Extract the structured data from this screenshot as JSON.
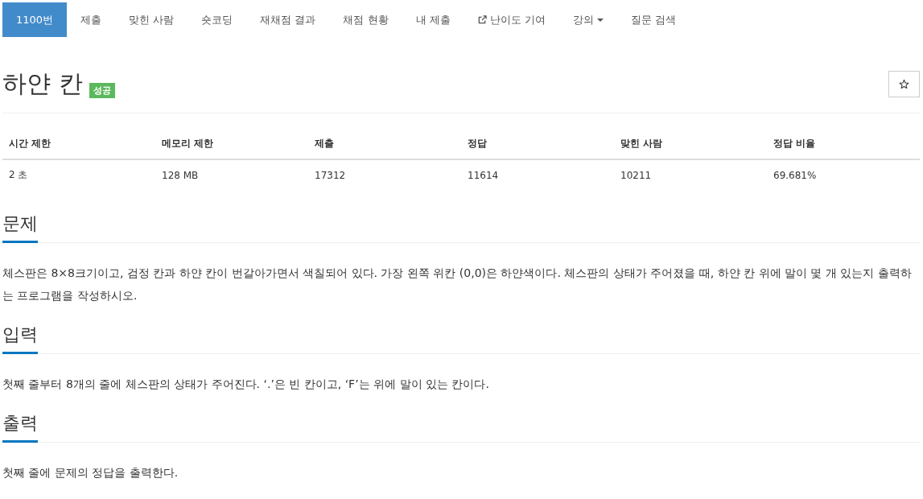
{
  "nav": {
    "tabs": [
      {
        "label": "1100번",
        "selected": true,
        "kind": "link"
      },
      {
        "label": "제출",
        "selected": false,
        "kind": "link"
      },
      {
        "label": "맞힌 사람",
        "selected": false,
        "kind": "link"
      },
      {
        "label": "숏코딩",
        "selected": false,
        "kind": "link"
      },
      {
        "label": "재채점 결과",
        "selected": false,
        "kind": "link"
      },
      {
        "label": "채점 현황",
        "selected": false,
        "kind": "link"
      },
      {
        "label": "내 제출",
        "selected": false,
        "kind": "link"
      },
      {
        "label": "난이도 기여",
        "selected": false,
        "kind": "external"
      },
      {
        "label": "강의",
        "selected": false,
        "kind": "dropdown"
      },
      {
        "label": "질문 검색",
        "selected": false,
        "kind": "link"
      }
    ]
  },
  "problem": {
    "title": "하얀 칸",
    "badge": "성공"
  },
  "table": {
    "columns": [
      "시간 제한",
      "메모리 제한",
      "제출",
      "정답",
      "맞힌 사람",
      "정답 비율"
    ],
    "rows": [
      [
        "2 초",
        "128 MB",
        "17312",
        "11614",
        "10211",
        "69.681%"
      ]
    ]
  },
  "sections": [
    {
      "heading": "문제",
      "text": "체스판은 8×8크기이고, 검정 칸과 하얀 칸이 번갈아가면서 색칠되어 있다. 가장 왼쪽 위칸 (0,0)은 하얀색이다. 체스판의 상태가 주어졌을 때, 하얀 칸 위에 말이 몇 개 있는지 출력하는 프로그램을 작성하시오."
    },
    {
      "heading": "입력",
      "text": "첫째 줄부터 8개의 줄에 체스판의 상태가 주어진다. ‘.’은 빈 칸이고, ‘F’는 위에 말이 있는 칸이다."
    },
    {
      "heading": "출력",
      "text": "첫째 줄에 문제의 정답을 출력한다."
    }
  ]
}
